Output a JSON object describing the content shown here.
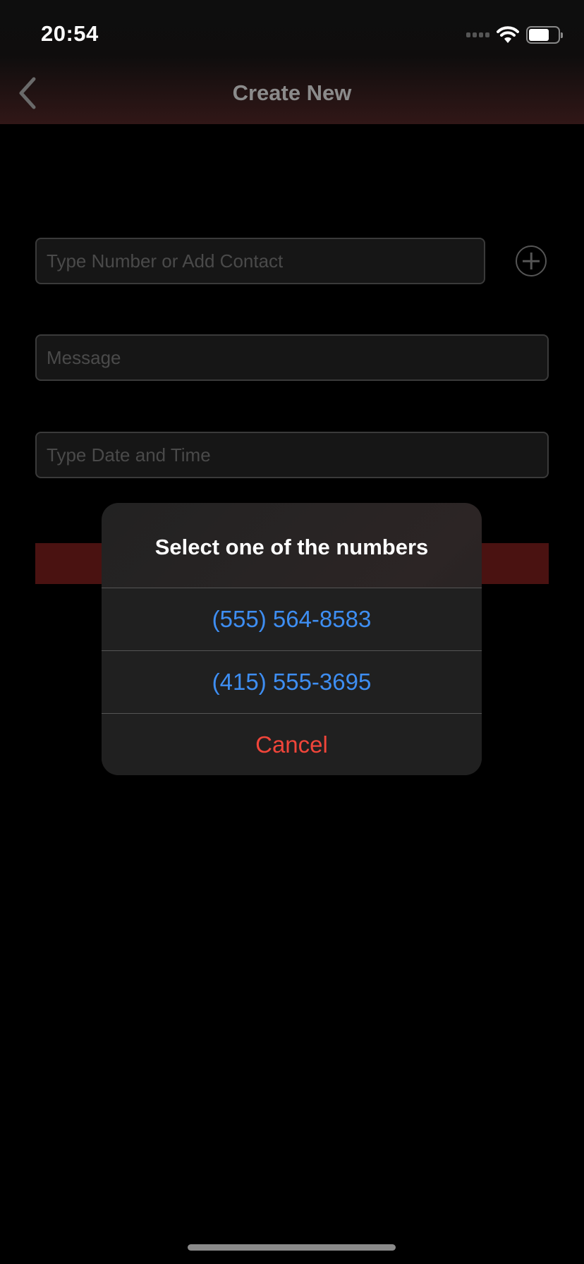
{
  "status_bar": {
    "time": "20:54"
  },
  "nav": {
    "title": "Create New"
  },
  "form": {
    "recipient_placeholder": "Type Number or Add Contact",
    "message_placeholder": "Message",
    "datetime_placeholder": "Type Date and Time"
  },
  "dialog": {
    "title": "Select one of the numbers",
    "options": [
      "(555) 564-8583",
      "(415) 555-3695"
    ],
    "cancel": "Cancel"
  },
  "colors": {
    "accent": "#3e8ef2",
    "destructive": "#f0453a",
    "button": "#4a1211"
  }
}
